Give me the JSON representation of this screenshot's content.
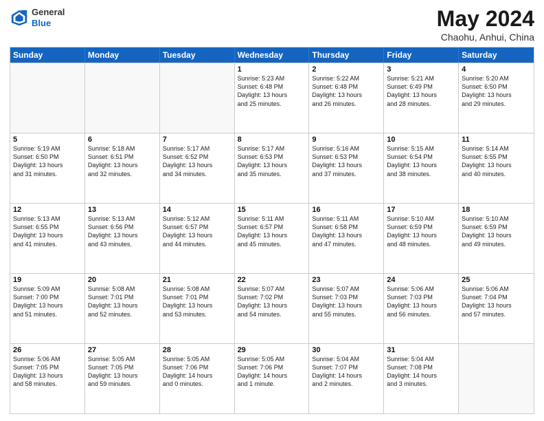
{
  "header": {
    "logo": {
      "general": "General",
      "blue": "Blue"
    },
    "title": "May 2024",
    "subtitle": "Chaohu, Anhui, China"
  },
  "weekdays": [
    "Sunday",
    "Monday",
    "Tuesday",
    "Wednesday",
    "Thursday",
    "Friday",
    "Saturday"
  ],
  "rows": [
    [
      {
        "day": "",
        "text": ""
      },
      {
        "day": "",
        "text": ""
      },
      {
        "day": "",
        "text": ""
      },
      {
        "day": "1",
        "text": "Sunrise: 5:23 AM\nSunset: 6:48 PM\nDaylight: 13 hours\nand 25 minutes."
      },
      {
        "day": "2",
        "text": "Sunrise: 5:22 AM\nSunset: 6:48 PM\nDaylight: 13 hours\nand 26 minutes."
      },
      {
        "day": "3",
        "text": "Sunrise: 5:21 AM\nSunset: 6:49 PM\nDaylight: 13 hours\nand 28 minutes."
      },
      {
        "day": "4",
        "text": "Sunrise: 5:20 AM\nSunset: 6:50 PM\nDaylight: 13 hours\nand 29 minutes."
      }
    ],
    [
      {
        "day": "5",
        "text": "Sunrise: 5:19 AM\nSunset: 6:50 PM\nDaylight: 13 hours\nand 31 minutes."
      },
      {
        "day": "6",
        "text": "Sunrise: 5:18 AM\nSunset: 6:51 PM\nDaylight: 13 hours\nand 32 minutes."
      },
      {
        "day": "7",
        "text": "Sunrise: 5:17 AM\nSunset: 6:52 PM\nDaylight: 13 hours\nand 34 minutes."
      },
      {
        "day": "8",
        "text": "Sunrise: 5:17 AM\nSunset: 6:53 PM\nDaylight: 13 hours\nand 35 minutes."
      },
      {
        "day": "9",
        "text": "Sunrise: 5:16 AM\nSunset: 6:53 PM\nDaylight: 13 hours\nand 37 minutes."
      },
      {
        "day": "10",
        "text": "Sunrise: 5:15 AM\nSunset: 6:54 PM\nDaylight: 13 hours\nand 38 minutes."
      },
      {
        "day": "11",
        "text": "Sunrise: 5:14 AM\nSunset: 6:55 PM\nDaylight: 13 hours\nand 40 minutes."
      }
    ],
    [
      {
        "day": "12",
        "text": "Sunrise: 5:13 AM\nSunset: 6:55 PM\nDaylight: 13 hours\nand 41 minutes."
      },
      {
        "day": "13",
        "text": "Sunrise: 5:13 AM\nSunset: 6:56 PM\nDaylight: 13 hours\nand 43 minutes."
      },
      {
        "day": "14",
        "text": "Sunrise: 5:12 AM\nSunset: 6:57 PM\nDaylight: 13 hours\nand 44 minutes."
      },
      {
        "day": "15",
        "text": "Sunrise: 5:11 AM\nSunset: 6:57 PM\nDaylight: 13 hours\nand 45 minutes."
      },
      {
        "day": "16",
        "text": "Sunrise: 5:11 AM\nSunset: 6:58 PM\nDaylight: 13 hours\nand 47 minutes."
      },
      {
        "day": "17",
        "text": "Sunrise: 5:10 AM\nSunset: 6:59 PM\nDaylight: 13 hours\nand 48 minutes."
      },
      {
        "day": "18",
        "text": "Sunrise: 5:10 AM\nSunset: 6:59 PM\nDaylight: 13 hours\nand 49 minutes."
      }
    ],
    [
      {
        "day": "19",
        "text": "Sunrise: 5:09 AM\nSunset: 7:00 PM\nDaylight: 13 hours\nand 51 minutes."
      },
      {
        "day": "20",
        "text": "Sunrise: 5:08 AM\nSunset: 7:01 PM\nDaylight: 13 hours\nand 52 minutes."
      },
      {
        "day": "21",
        "text": "Sunrise: 5:08 AM\nSunset: 7:01 PM\nDaylight: 13 hours\nand 53 minutes."
      },
      {
        "day": "22",
        "text": "Sunrise: 5:07 AM\nSunset: 7:02 PM\nDaylight: 13 hours\nand 54 minutes."
      },
      {
        "day": "23",
        "text": "Sunrise: 5:07 AM\nSunset: 7:03 PM\nDaylight: 13 hours\nand 55 minutes."
      },
      {
        "day": "24",
        "text": "Sunrise: 5:06 AM\nSunset: 7:03 PM\nDaylight: 13 hours\nand 56 minutes."
      },
      {
        "day": "25",
        "text": "Sunrise: 5:06 AM\nSunset: 7:04 PM\nDaylight: 13 hours\nand 57 minutes."
      }
    ],
    [
      {
        "day": "26",
        "text": "Sunrise: 5:06 AM\nSunset: 7:05 PM\nDaylight: 13 hours\nand 58 minutes."
      },
      {
        "day": "27",
        "text": "Sunrise: 5:05 AM\nSunset: 7:05 PM\nDaylight: 13 hours\nand 59 minutes."
      },
      {
        "day": "28",
        "text": "Sunrise: 5:05 AM\nSunset: 7:06 PM\nDaylight: 14 hours\nand 0 minutes."
      },
      {
        "day": "29",
        "text": "Sunrise: 5:05 AM\nSunset: 7:06 PM\nDaylight: 14 hours\nand 1 minute."
      },
      {
        "day": "30",
        "text": "Sunrise: 5:04 AM\nSunset: 7:07 PM\nDaylight: 14 hours\nand 2 minutes."
      },
      {
        "day": "31",
        "text": "Sunrise: 5:04 AM\nSunset: 7:08 PM\nDaylight: 14 hours\nand 3 minutes."
      },
      {
        "day": "",
        "text": ""
      }
    ]
  ]
}
